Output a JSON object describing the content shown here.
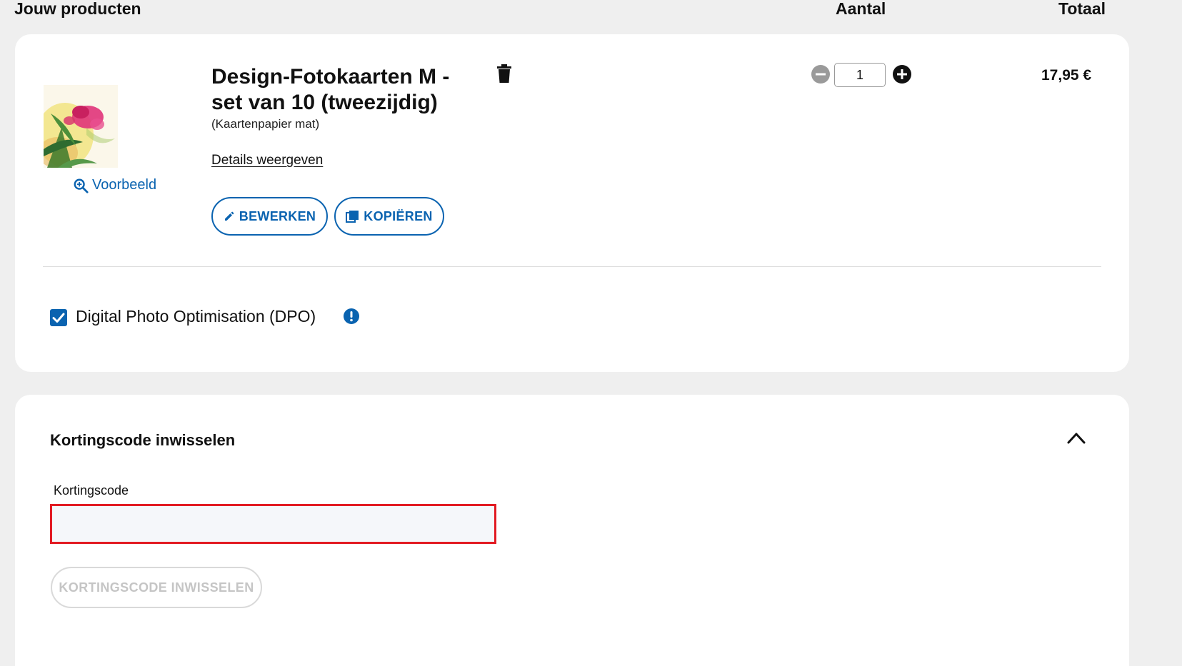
{
  "header": {
    "products": "Jouw producten",
    "quantity": "Aantal",
    "total": "Totaal"
  },
  "product": {
    "title": "Design-Fotokaarten M - set van 10 (tweezijdig)",
    "subtitle": "(Kaartenpapier mat)",
    "details_link": "Details weergeven",
    "preview_label": "Voorbeeld",
    "edit_label": "BEWERKEN",
    "copy_label": "KOPIËREN",
    "quantity": "1",
    "price": "17,95 €"
  },
  "option": {
    "dpo_label": "Digital Photo Optimisation (DPO)",
    "dpo_checked": true
  },
  "coupon": {
    "title": "Kortingscode inwisselen",
    "field_label": "Kortingscode",
    "value": "",
    "button_label": "KORTINGSCODE INWISSELEN"
  },
  "colors": {
    "accent": "#0a63b0",
    "error_border": "#e21b23",
    "page_bg": "#efefef",
    "disabled_text": "#c5c5c5"
  },
  "icons": [
    "search-zoom-icon",
    "pencil-icon",
    "copy-icon",
    "trash-icon",
    "minus-circle-icon",
    "plus-circle-icon",
    "checkbox-icon",
    "info-icon",
    "chevron-up-icon"
  ]
}
